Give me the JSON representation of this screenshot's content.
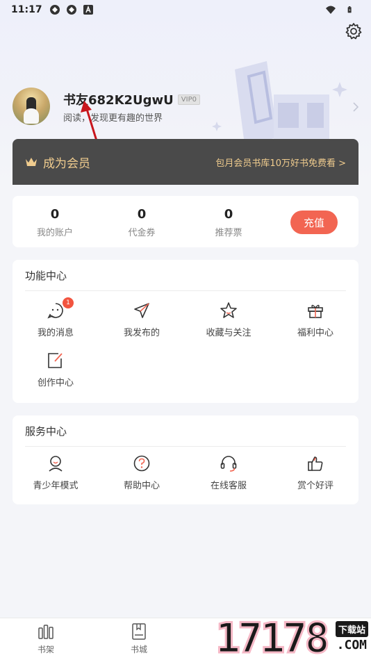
{
  "status_bar": {
    "time": "11:17"
  },
  "profile": {
    "username": "书友682K2UgwU",
    "vip_level": "VIP0",
    "tagline": "阅读，发现更有趣的世界"
  },
  "membership": {
    "title": "成为会员",
    "description": "包月会员书库10万好书免费看 >"
  },
  "stats": [
    {
      "value": "0",
      "label": "我的账户"
    },
    {
      "value": "0",
      "label": "代金券"
    },
    {
      "value": "0",
      "label": "推荐票"
    }
  ],
  "recharge_label": "充值",
  "function_center": {
    "title": "功能中心",
    "items": [
      {
        "label": "我的消息",
        "icon": "message-icon",
        "badge": "1"
      },
      {
        "label": "我发布的",
        "icon": "paper-plane-icon"
      },
      {
        "label": "收藏与关注",
        "icon": "star-icon"
      },
      {
        "label": "福利中心",
        "icon": "gift-icon"
      },
      {
        "label": "创作中心",
        "icon": "edit-icon"
      }
    ]
  },
  "service_center": {
    "title": "服务中心",
    "items": [
      {
        "label": "青少年模式",
        "icon": "youth-mode-icon"
      },
      {
        "label": "帮助中心",
        "icon": "help-icon"
      },
      {
        "label": "在线客服",
        "icon": "headset-icon"
      },
      {
        "label": "赏个好评",
        "icon": "thumbs-up-icon"
      }
    ]
  },
  "tabbar": [
    {
      "label": "书架",
      "icon": "bookshelf-icon"
    },
    {
      "label": "书城",
      "icon": "bookstore-icon"
    }
  ],
  "watermark": {
    "number": "17178",
    "label": "下载站",
    "suffix": ".COM"
  },
  "colors": {
    "accent": "#f26552",
    "member_bg": "#4a4a4a",
    "member_gold": "#f0cc8e",
    "page_bg": "#f4f5f9"
  }
}
